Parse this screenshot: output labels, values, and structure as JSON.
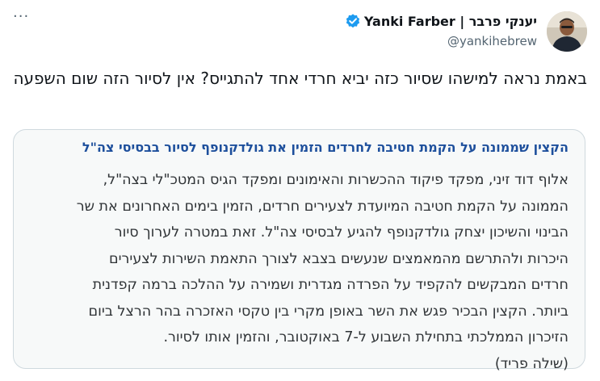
{
  "author": {
    "display_name": "יענקי פרבר | Yanki Farber",
    "handle": "@yankihebrew",
    "verified": true,
    "verified_color": "#1d9bf0"
  },
  "tweet": {
    "text": "באמת נראה למישהו שסיור כזה יביא חרדי אחד להתגייס? אין לסיור הזה שום השפעה"
  },
  "quoted_article": {
    "title": "הקצין שממונה על הקמת חטיבה לחרדים הזמין את גולדקנופף לסיור בבסיסי צה\"ל",
    "lines": [
      "אלוף דוד זיני, מפקד פיקוד ההכשרות והאימונים ומפקד הגיס המטכ\"לי בצה\"ל,",
      "הממונה על הקמת חטיבה המיועדת לצעירים חרדים, הזמין בימים האחרונים את שר",
      "הבינוי והשיכון יצחק גולדקנופף להגיע לבסיסי צה\"ל. זאת במטרה לערוך סיור",
      "היכרות ולהתרשם מהמאמצים שנעשים בצבא לצורך התאמת השירות לצעירים",
      "חרדים המבקשים להקפיד על הפרדה מגדרית ושמירה על ההלכה ברמה קפדנית",
      "ביותר. הקצין הבכיר פגש את השר באופן מקרי בין טקסי האזכרה בהר הרצל ביום",
      "הזיכרון הממלכתי בתחילת השבוע ל-7 באוקטובר, והזמין אותו לסיור.",
      "(שילה פריד)"
    ]
  },
  "menu": {
    "more_icon": "more-horizontal-icon",
    "more_glyph": "···"
  }
}
